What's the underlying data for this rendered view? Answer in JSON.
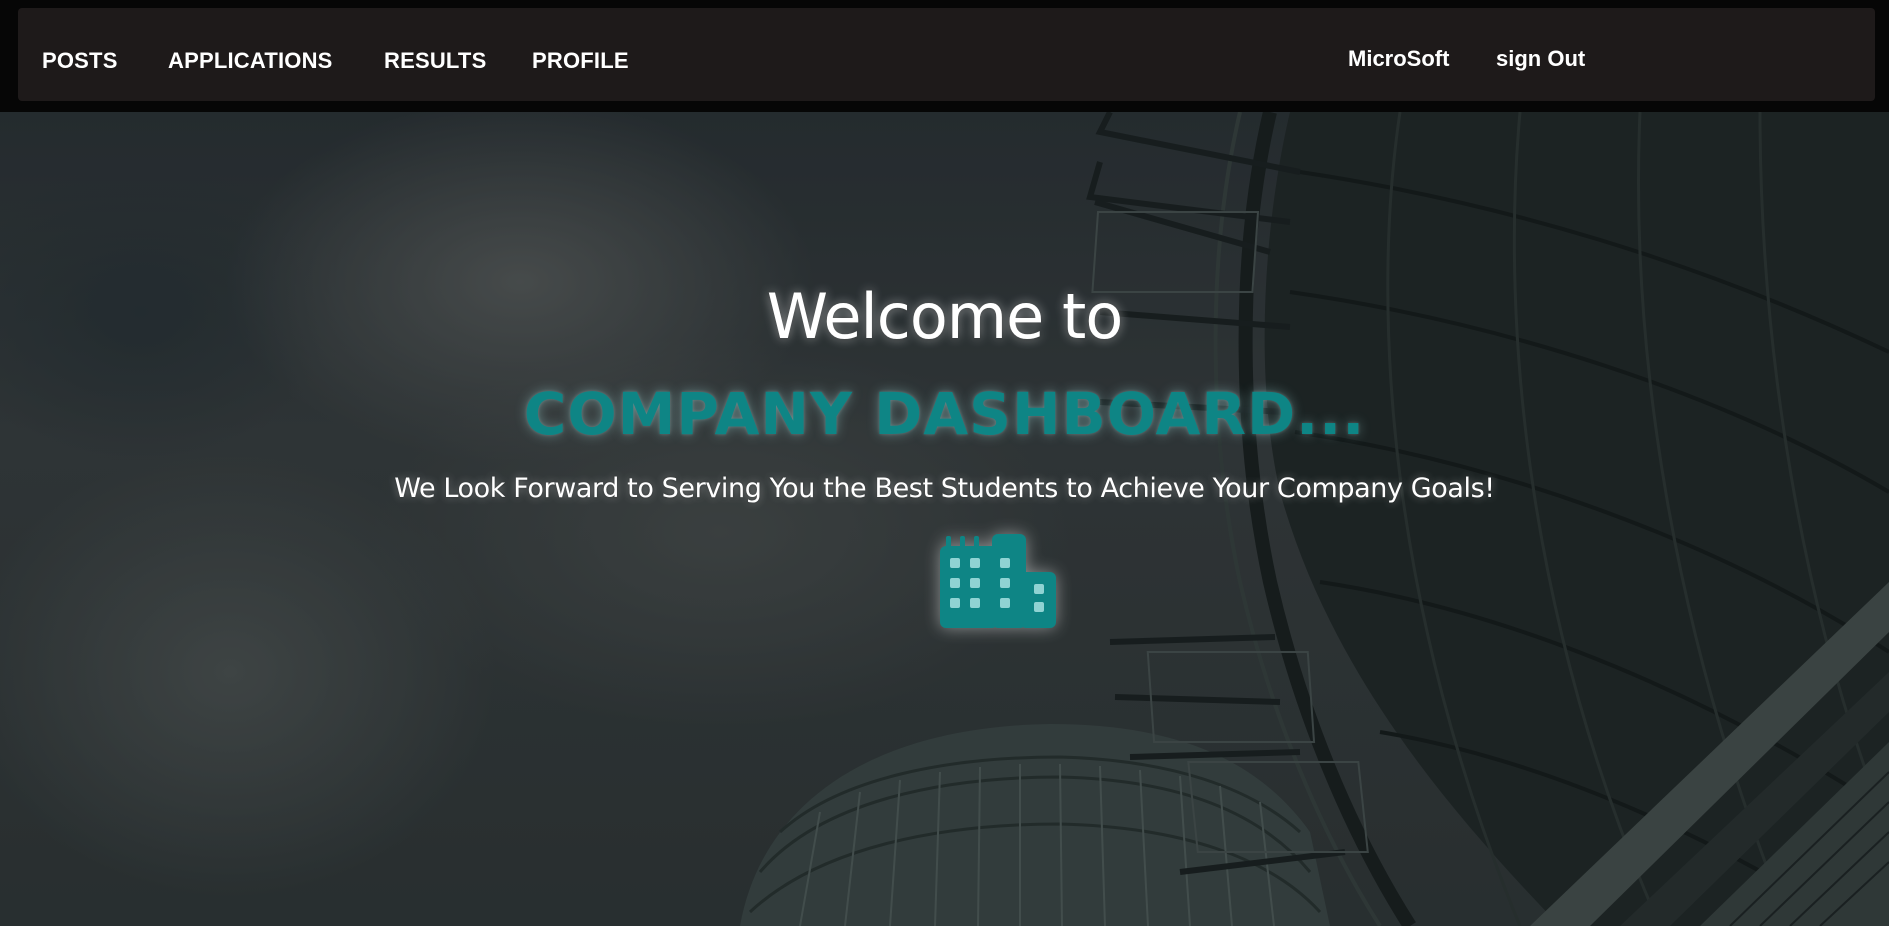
{
  "navbar": {
    "links": [
      {
        "label": "POSTS"
      },
      {
        "label": "APPLICATIONS"
      },
      {
        "label": "RESULTS"
      },
      {
        "label": "PROFILE"
      }
    ],
    "company_name": "MicroSoft",
    "sign_out_label": "sign Out"
  },
  "hero": {
    "welcome": "Welcome to",
    "title": "COMPANY DASHBOARD...",
    "tagline": "We Look Forward to Serving You the Best Students to Achieve Your Company Goals!",
    "icon": "building-icon"
  },
  "colors": {
    "accent": "#0e8585",
    "navbar_bg": "#1e1a1a",
    "nav_text": "#ffffff"
  }
}
